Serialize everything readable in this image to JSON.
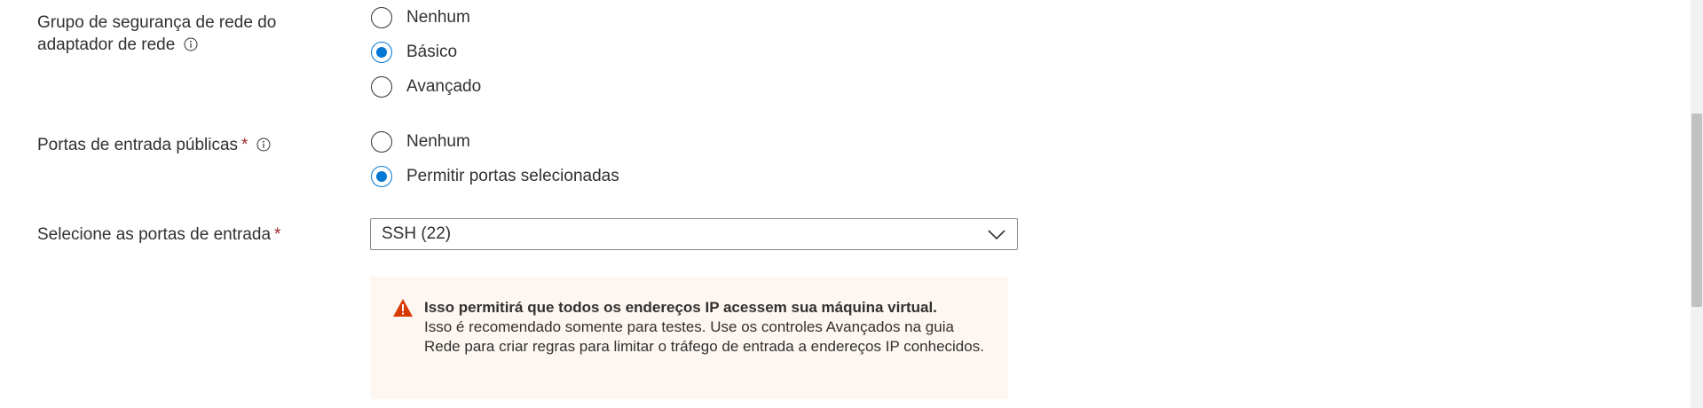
{
  "nic_nsg": {
    "label_line1": "Grupo de segurança de rede do",
    "label_line2": "adaptador de rede",
    "info_icon": "info-icon",
    "options": [
      {
        "label": "Nenhum",
        "checked": false
      },
      {
        "label": "Básico",
        "checked": true
      },
      {
        "label": "Avançado",
        "checked": false
      }
    ]
  },
  "public_ports": {
    "label": "Portas de entrada públicas",
    "required_marker": "*",
    "info_icon": "info-icon",
    "options": [
      {
        "label": "Nenhum",
        "checked": false
      },
      {
        "label": "Permitir portas selecionadas",
        "checked": true
      }
    ]
  },
  "inbound_ports": {
    "label": "Selecione as portas de entrada",
    "required_marker": "*",
    "selected_value": "SSH (22)",
    "icon": "chevron-down-icon"
  },
  "warning": {
    "icon": "warning-icon",
    "icon_color": "#d83b01",
    "title": "Isso permitirá que todos os endereços IP acessem sua máquina virtual.",
    "body": "Isso é recomendado somente para testes.  Use os controles Avançados na guia Rede para criar regras para limitar o tráfego de entrada a endereços IP conhecidos."
  },
  "colors": {
    "accent": "#0078d4",
    "required": "#a4262c",
    "warning_bg": "#fdf6f1"
  }
}
